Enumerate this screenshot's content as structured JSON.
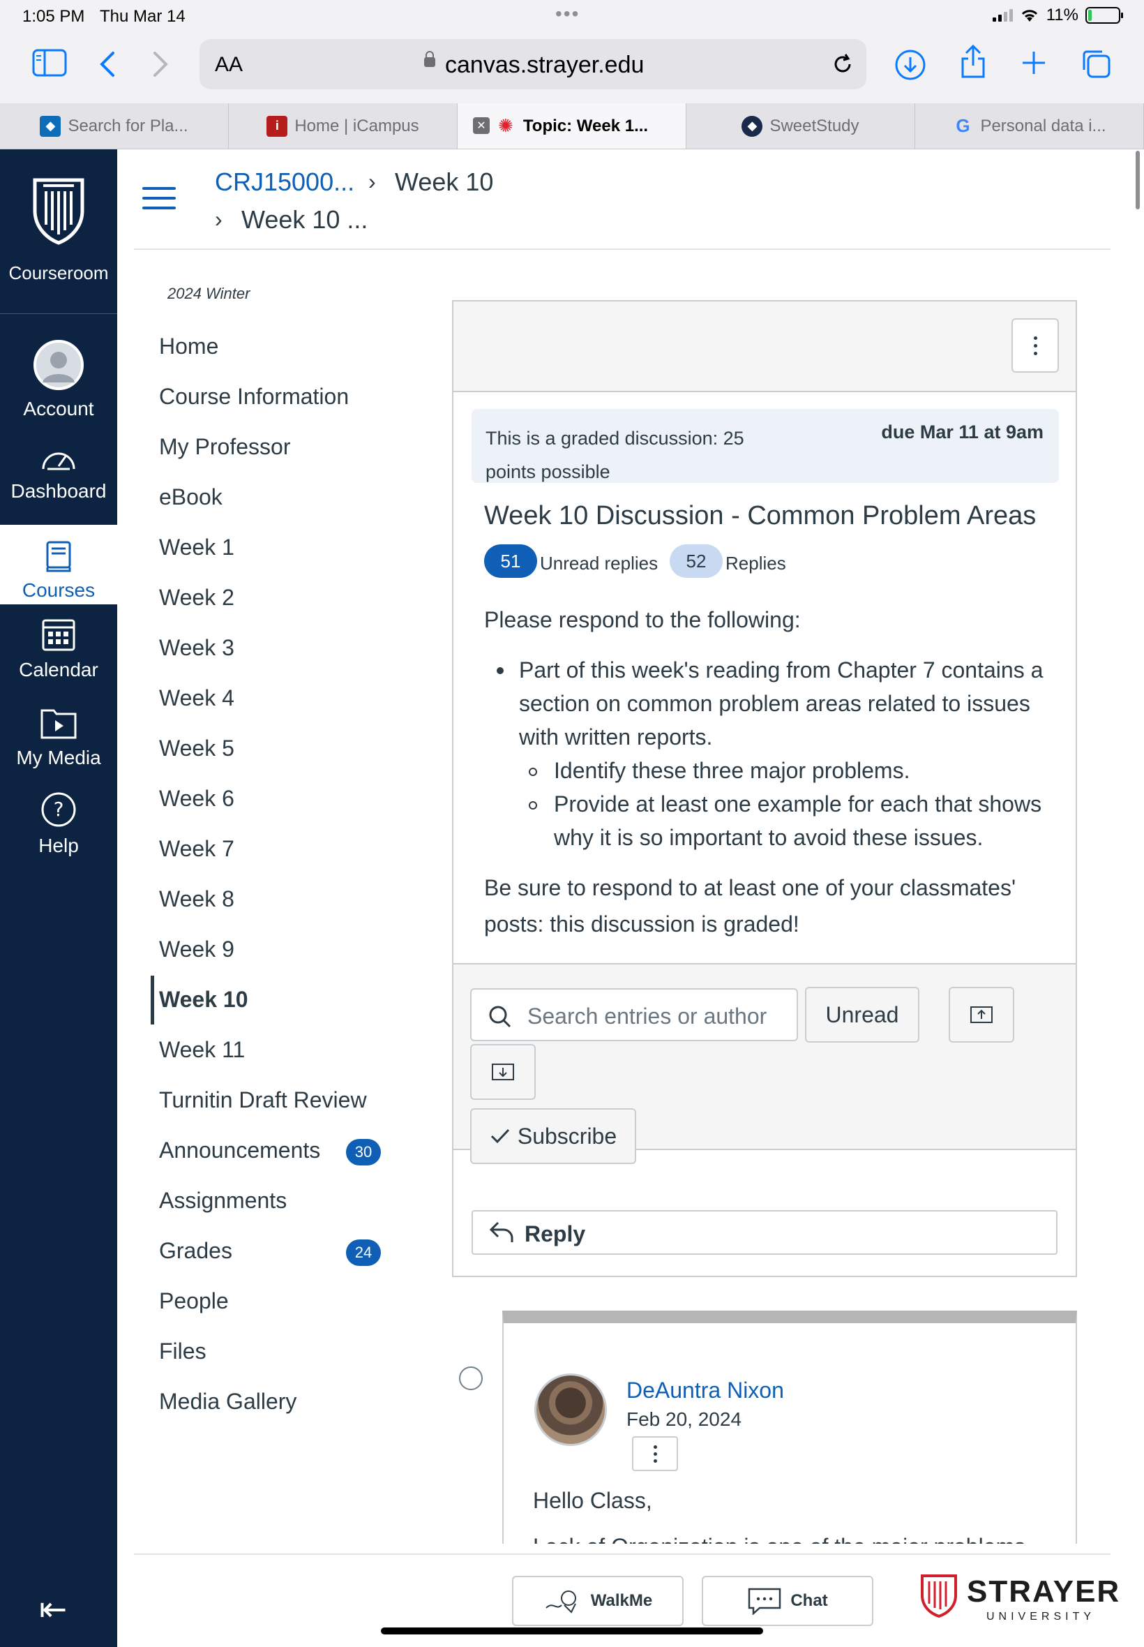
{
  "status": {
    "time": "1:05 PM",
    "date": "Thu Mar 14",
    "battery": "11%",
    "battery_level": 0.11
  },
  "browser": {
    "aa_label": "AA",
    "url": "canvas.strayer.edu",
    "tabs": [
      {
        "label": "Search for Pla...",
        "active": false
      },
      {
        "label": "Home | iCampus",
        "active": false
      },
      {
        "label": "Topic: Week 1...",
        "active": true
      },
      {
        "label": "SweetStudy",
        "active": false
      },
      {
        "label": "Personal data i...",
        "active": false
      }
    ]
  },
  "global_nav": {
    "brand_label": "Courseroom",
    "items": [
      {
        "label": "Account",
        "icon": "account-icon"
      },
      {
        "label": "Dashboard",
        "icon": "dashboard-icon"
      },
      {
        "label": "Courses",
        "icon": "courses-icon",
        "active": true
      },
      {
        "label": "Calendar",
        "icon": "calendar-icon"
      },
      {
        "label": "My Media",
        "icon": "my-media-icon"
      },
      {
        "label": "Help",
        "icon": "help-icon"
      }
    ]
  },
  "breadcrumb": {
    "course": "CRJ15000...",
    "section": "Week 10",
    "topic": "Week 10 ..."
  },
  "course_nav": {
    "term": "2024 Winter",
    "items": [
      {
        "label": "Home"
      },
      {
        "label": "Course Information"
      },
      {
        "label": "My Professor"
      },
      {
        "label": "eBook"
      },
      {
        "label": "Week 1"
      },
      {
        "label": "Week 2"
      },
      {
        "label": "Week 3"
      },
      {
        "label": "Week 4"
      },
      {
        "label": "Week 5"
      },
      {
        "label": "Week 6"
      },
      {
        "label": "Week 7"
      },
      {
        "label": "Week 8"
      },
      {
        "label": "Week 9"
      },
      {
        "label": "Week 10",
        "active": true
      },
      {
        "label": "Week 11"
      },
      {
        "label": "Turnitin Draft Review"
      },
      {
        "label": "Announcements",
        "badge": "30"
      },
      {
        "label": "Assignments"
      },
      {
        "label": "Grades",
        "badge": "24"
      },
      {
        "label": "People"
      },
      {
        "label": "Files"
      },
      {
        "label": "Media Gallery"
      }
    ]
  },
  "discussion": {
    "graded_line1": "This is a graded discussion: 25",
    "graded_line2": "points possible",
    "due": "due Mar 11 at 9am",
    "title": "Week 10 Discussion - Common Problem Areas",
    "unread_count": "51",
    "unread_label": "Unread replies",
    "replies_count": "52",
    "replies_label": "Replies",
    "intro": "Please respond to the following:",
    "bullet_lines": [
      "Part of this week's reading from Chapter 7 contains a",
      "section on common problem areas related to issues",
      "with written reports."
    ],
    "sub_bullet_1": "Identify these three major problems.",
    "sub_bullet_2_lines": [
      "Provide at least one example for each that shows",
      "why it is so important to avoid these issues."
    ],
    "closing_lines": [
      "Be sure to respond to at least one of your classmates'",
      "posts: this discussion is graded!"
    ],
    "search_placeholder": "Search entries or author",
    "unread_button": "Unread",
    "subscribe_button": "Subscribe",
    "reply_button": "Reply"
  },
  "entry": {
    "author": "DeAuntra Nixon",
    "date": "Feb 20, 2024",
    "greeting": "Hello Class,",
    "line2": "Lack of Organization is one of the major problems"
  },
  "footer": {
    "walkme": "WalkMe",
    "chat": "Chat",
    "logo_word": "STRAYER",
    "logo_sub": "UNIVERSITY"
  },
  "colors": {
    "nav_bg": "#0c2342",
    "link": "#0e5fb5",
    "badge": "#0e5fb5",
    "text": "#2d3b45"
  }
}
